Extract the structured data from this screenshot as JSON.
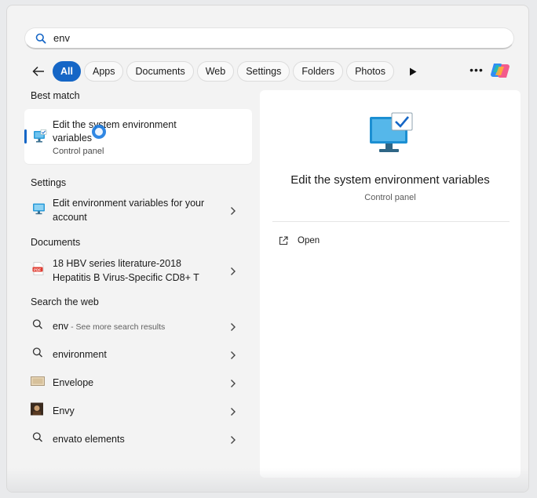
{
  "search": {
    "value": "env",
    "placeholder": ""
  },
  "filters": [
    "All",
    "Apps",
    "Documents",
    "Web",
    "Settings",
    "Folders",
    "Photos"
  ],
  "sections": {
    "best_match": "Best match",
    "settings": "Settings",
    "documents": "Documents",
    "search_web": "Search the web"
  },
  "best_match": {
    "title": "Edit the system environment variables",
    "subtitle": "Control panel"
  },
  "settings_items": [
    {
      "label": "Edit environment variables for your account"
    }
  ],
  "documents_items": [
    {
      "label": "18 HBV series literature-2018 Hepatitis B Virus-Specific CD8+ T"
    }
  ],
  "web_items": [
    {
      "label": "env",
      "hint": " - See more search results",
      "icon": "search-icon"
    },
    {
      "label": "environment",
      "hint": "",
      "icon": "search-icon"
    },
    {
      "label": "Envelope",
      "hint": "",
      "icon": "envelope-thumbnail"
    },
    {
      "label": "Envy",
      "hint": "",
      "icon": "envy-thumbnail"
    },
    {
      "label": "envato elements",
      "hint": "",
      "icon": "search-icon"
    }
  ],
  "preview": {
    "title": "Edit the system environment variables",
    "subtitle": "Control panel",
    "action": "Open"
  },
  "colors": {
    "accent": "#1566c6",
    "pane_bg": "#f3f3f3",
    "card_bg": "#ffffff"
  }
}
